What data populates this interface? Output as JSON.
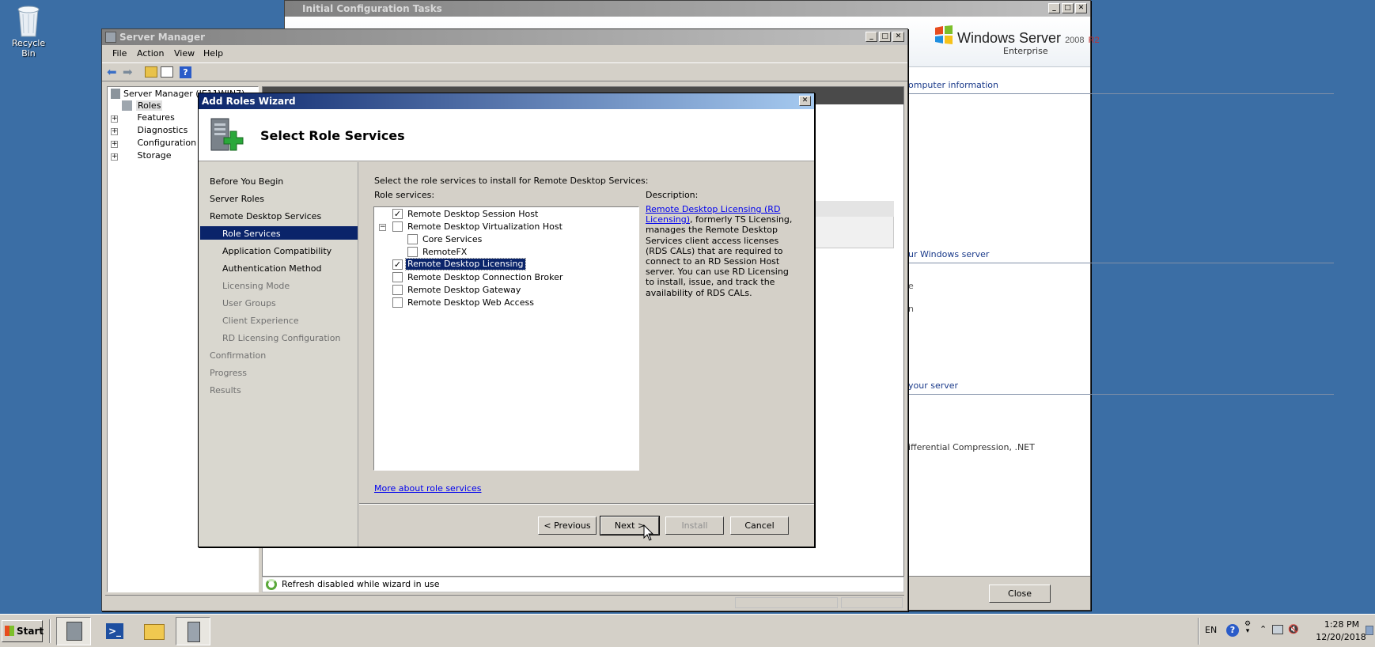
{
  "desktop": {
    "recycle_bin_label": "Recycle Bin"
  },
  "init_tasks_window": {
    "title": "Initial Configuration Tasks",
    "brand_main": "Windows Server",
    "brand_version": "2008",
    "brand_r2": "R2",
    "brand_edition": "Enterprise",
    "section1": "omputer information",
    "section2": "ur Windows server",
    "line_e": "e",
    "line_n": "n",
    "section3": "your server",
    "compression_text": "ifferential Compression, .NET",
    "close_label": "Close"
  },
  "server_manager": {
    "title": "Server Manager",
    "menu": [
      "File",
      "Action",
      "View",
      "Help"
    ],
    "tree_root": "Server Manager (IE11WIN7)",
    "tree_items": [
      "Roles",
      "Features",
      "Diagnostics",
      "Configuration",
      "Storage"
    ],
    "status_text": "Refresh disabled while wizard in use"
  },
  "wizard": {
    "title": "Add Roles Wizard",
    "heading": "Select Role Services",
    "nav": [
      "Before You Begin",
      "Server Roles",
      "Remote Desktop Services",
      "Role Services",
      "Application Compatibility",
      "Authentication Method",
      "Licensing Mode",
      "User Groups",
      "Client Experience",
      "RD Licensing Configuration",
      "Confirmation",
      "Progress",
      "Results"
    ],
    "nav_selected_index": 3,
    "instruction": "Select the role services to install for Remote Desktop Services:",
    "role_services_label": "Role services:",
    "role_services": [
      {
        "label": "Remote Desktop Session Host",
        "checked": true
      },
      {
        "label": "Remote Desktop Virtualization Host",
        "checked": false,
        "expander": "collapse"
      },
      {
        "label": "Core Services",
        "checked": false
      },
      {
        "label": "RemoteFX",
        "checked": false
      },
      {
        "label": "Remote Desktop Licensing",
        "checked": true,
        "selected": true
      },
      {
        "label": "Remote Desktop Connection Broker",
        "checked": false
      },
      {
        "label": "Remote Desktop Gateway",
        "checked": false
      },
      {
        "label": "Remote Desktop Web Access",
        "checked": false
      }
    ],
    "description_label": "Description:",
    "description_link": "Remote Desktop Licensing (RD Licensing)",
    "description_text": ", formerly TS Licensing, manages the Remote Desktop Services client access licenses (RDS CALs) that are required to connect to an RD Session Host server. You can use RD Licensing to install, issue, and track the availability of RDS CALs.",
    "more_link": "More about role services",
    "buttons": {
      "previous": "< Previous",
      "next": "Next >",
      "install": "Install",
      "cancel": "Cancel"
    }
  },
  "taskbar": {
    "start_label": "Start",
    "language": "EN",
    "time": "1:28 PM",
    "date": "12/20/2018"
  },
  "colors": {
    "desktop": "#3b6ea5",
    "nav_selected": "#0a246a",
    "title_active": "#0a246a"
  }
}
